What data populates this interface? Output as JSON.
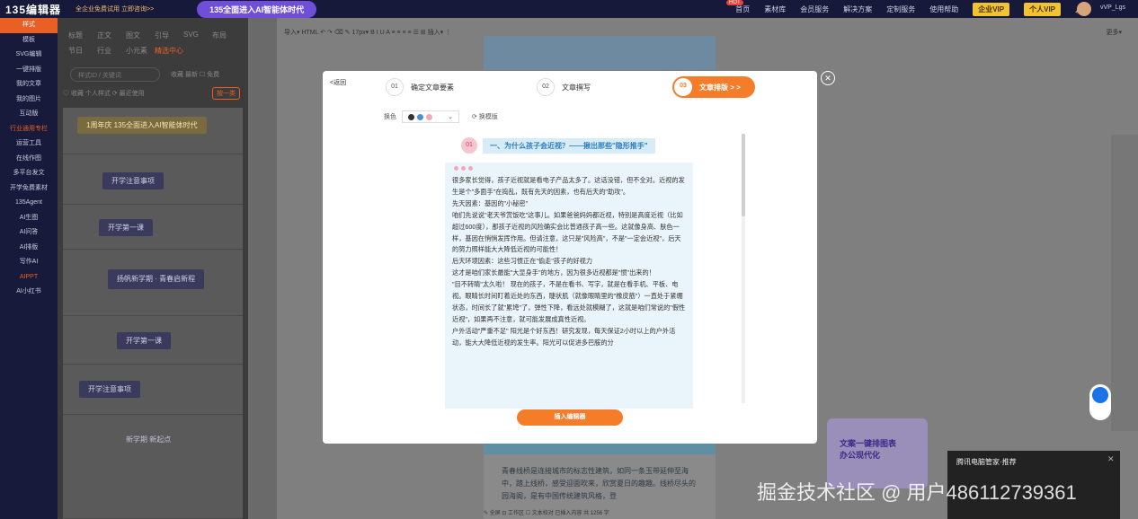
{
  "topbar": {
    "logo": "135编辑器",
    "promo": "全企业免费试用 立即咨询>>",
    "banner": "135全面进入AI智能体时代",
    "nav": [
      "首页",
      "素材库",
      "会员服务",
      "解决方案",
      "定制服务",
      "使用帮助"
    ],
    "hot_badge": "HOT",
    "vip_enterprise": "企业VIP",
    "vip_personal": "个人VIP",
    "user": "vVP_Lgs"
  },
  "sidebar": {
    "items": [
      "样式",
      "模板",
      "SVG编辑",
      "一键排版",
      "我的文章",
      "我的图片",
      "互动版",
      "行业通用专栏",
      "运营工具",
      "在线作图",
      "多平台发文",
      "开学免费素材",
      "135Agent",
      "AI生图",
      "AI问答",
      "AI排版",
      "写作AI",
      "AIPPT",
      "AI小红书"
    ]
  },
  "material_panel": {
    "categories": [
      "标题",
      "正文",
      "图文",
      "引导",
      "SVG",
      "布局",
      "节日",
      "行业",
      "小元素",
      "精选中心"
    ],
    "search_placeholder": "样式ID / 关键词",
    "options": "收藏  最新  ☐ 免费",
    "filters": "♡ 收藏   个人样式   ⟳ 最近使用",
    "one_click": "按一类",
    "cards": [
      "1周年庆 135全面进入AI智能体时代",
      "开学注意事项",
      "开学第一课",
      "扬帆新学期 · 青春启新程",
      "开学第一课",
      "开学注意事项",
      "新学期 新起点"
    ]
  },
  "editor": {
    "toolbar": "导入▾  HTML  ↶  ↷  ⌫  ✎  17px▾  B  I  U  A  ≡  ≡  ≡  ≡  ☰  ⊞  插入▾  ⋮",
    "more": "更多▾",
    "body_text": "青春线桥是连接城市的标志性建筑，如同一条玉带延伸至海中，踏上线桥，感受迎面吹来，欣赏夏日的趣趣。线桥尽头的园海阁，是有中国传统建筑风格，登",
    "status": "✎ 全屏  ⊡ 工作区  ☐ 文本校对   已插入内容 共 1256 字"
  },
  "modal": {
    "back": "<返回",
    "steps": [
      {
        "num": "01",
        "label": "确定文章要素"
      },
      {
        "num": "02",
        "label": "文章撰写"
      },
      {
        "num": "03",
        "label": "文章排版 > >"
      }
    ],
    "color_label": "换色",
    "swap_label": "⟳ 换模版",
    "colors": [
      "#333333",
      "#4a90d9",
      "#f4a7b9"
    ],
    "section_num": "01",
    "section_title": "一、为什么孩子会近视？——揪出那些\"隐形推手\"",
    "body": "很多家长觉得，孩子近视就是看电子产品太多了。这话没错，但不全对。近视的发生是个\"多面手\"在捣乱，既有先天的因素，也有后天的\"助攻\"。\n先天因素：基因的\"小秘密\"\n咱们先说说\"老天爷赏饭吃\"这事儿。如果爸爸妈妈都近视，特别是高度近视（比如超过600度），那孩子近视的风险确实会比普通孩子高一些。这就像身高、肤色一样，基因在悄悄发挥作用。但请注意，这只是\"风险高\"，不是\"一定会近视\"，后天的努力照样能大大降低近视的可能性！\n后天环境因素：这些习惯正在\"偷走\"孩子的好视力\n这才是咱们家长最能\"大显身手\"的地方，因为很多近视都是\"惯\"出来的！\n\"目不转睛\"太久啦！ 现在的孩子，不是在看书、写字，就是在看手机、平板、电视。眼睛长时间盯着近处的东西，睫状肌（就像眼睛里的\"橡皮筋\"）一直处于紧绷状态，时间长了就\"累垮\"了，弹性下降，看远处就模糊了，这就是咱们常说的\"假性近视\"，如果再不注意，就可能发展成真性近视。\n户外活动\"严重不足\" 阳光是个好东西！研究发现，每天保证2小时以上的户外活动，能大大降低近视的发生率。阳光可以促进多巴胺的分",
    "insert_button": "插入编辑器"
  },
  "ad": {
    "text": "文案一键排图表\n办公现代化"
  },
  "toast": {
    "title": "腾讯电脑管家·推荐"
  },
  "watermark": "掘金技术社区 @ 用户486112739361"
}
